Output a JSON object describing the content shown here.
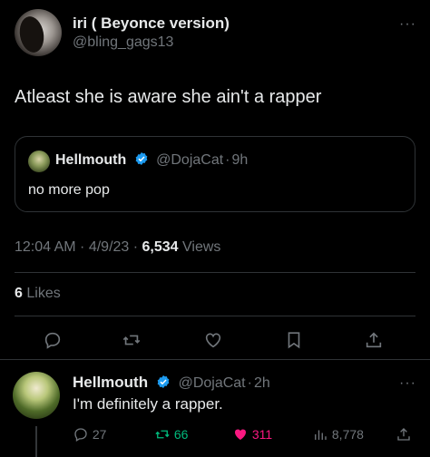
{
  "post": {
    "author_name": "iri ( Beyonce version)",
    "author_handle": "@bling_gags13",
    "more_label": "···",
    "text": "Atleast she is aware she ain't a rapper",
    "quote": {
      "author_name": "Hellmouth",
      "author_handle": "@DojaCat",
      "time": "9h",
      "text": "no more pop"
    },
    "timestamp": "12:04 AM · 4/9/23 ·",
    "views_count": "6,534",
    "views_label": "Views",
    "likes_count": "6",
    "likes_label": "Likes"
  },
  "actions": [
    "reply-icon",
    "retweet-icon",
    "like-icon",
    "bookmark-icon",
    "share-icon"
  ],
  "reply": {
    "author_name": "Hellmouth",
    "author_handle": "@DojaCat",
    "time": "2h",
    "more_label": "···",
    "text": "I'm definitely a rapper.",
    "replies": "27",
    "retweets": "66",
    "likes": "311",
    "views": "8,778"
  },
  "colors": {
    "background": "#000000",
    "text": "#e7e9ea",
    "muted": "#71767b",
    "verified": "#1d9bf0",
    "retweet": "#00ba7c",
    "like": "#f91880",
    "divider": "#2f3336"
  }
}
